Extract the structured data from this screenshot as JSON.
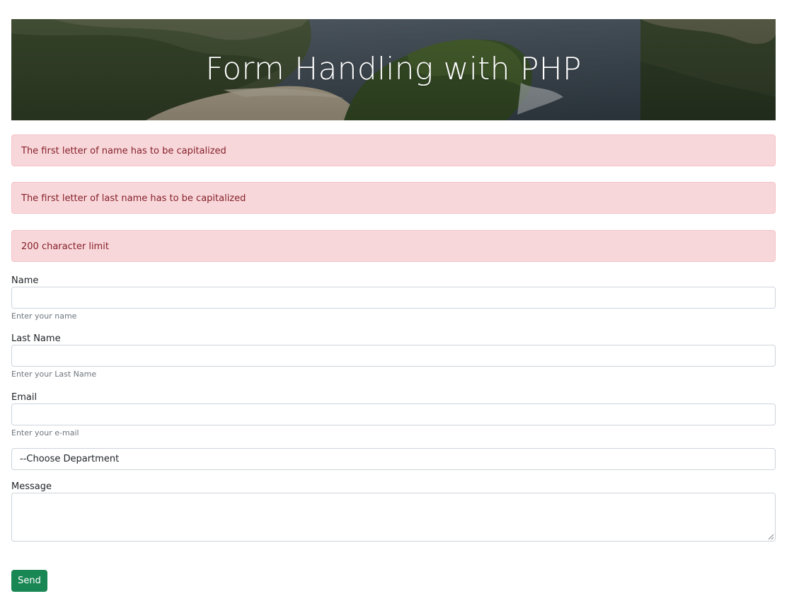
{
  "header": {
    "title": "Form Handling with PHP"
  },
  "alerts": [
    "The first letter of name has to be capitalized",
    "The first letter of last name has to be capitalized",
    "200 character limit"
  ],
  "form": {
    "name": {
      "label": "Name",
      "value": "",
      "help": "Enter your name"
    },
    "last_name": {
      "label": "Last Name",
      "value": "",
      "help": "Enter your Last Name"
    },
    "email": {
      "label": "Email",
      "value": "",
      "help": "Enter your e-mail"
    },
    "department": {
      "selected": "--Choose Department"
    },
    "message": {
      "label": "Message",
      "value": ""
    },
    "send_label": "Send"
  },
  "colors": {
    "alert_bg": "#f8d7da",
    "alert_text": "#842029",
    "send_button": "#198754"
  }
}
